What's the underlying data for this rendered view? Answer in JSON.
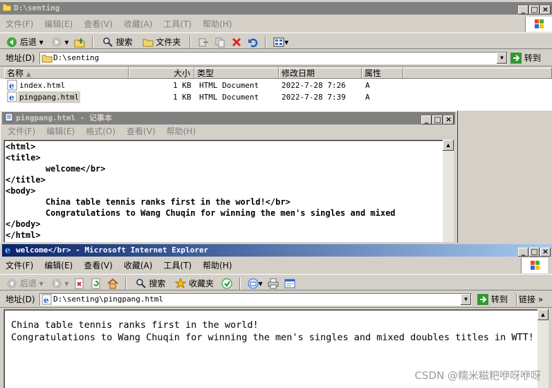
{
  "explorer": {
    "title": "D:\\senting",
    "menu": [
      "文件(F)",
      "编辑(E)",
      "查看(V)",
      "收藏(A)",
      "工具(T)",
      "帮助(H)"
    ],
    "toolbar": {
      "back": "后退",
      "search": "搜索",
      "folders": "文件夹"
    },
    "address_label": "地址(D)",
    "address_value": "D:\\senting",
    "go_label": "转到",
    "columns": [
      "名称",
      "大小",
      "类型",
      "修改日期",
      "属性"
    ],
    "files": [
      {
        "name": "index.html",
        "size": "1 KB",
        "type": "HTML Document",
        "modified": "2022-7-28 7:26",
        "attr": "A"
      },
      {
        "name": "pingpang.html",
        "size": "1 KB",
        "type": "HTML Document",
        "modified": "2022-7-28 7:39",
        "attr": "A"
      }
    ]
  },
  "notepad": {
    "title": "pingpang.html - 记事本",
    "menu": [
      "文件(F)",
      "编辑(E)",
      "格式(O)",
      "查看(V)",
      "帮助(H)"
    ],
    "lines": [
      "<html>",
      "<title>",
      "        welcome</br>",
      "</title>",
      "<body>",
      "        China table tennis ranks first in the world!</br>",
      "        Congratulations to Wang Chuqin for winning the men's singles and mixed",
      "</body>",
      "</html>"
    ]
  },
  "ie": {
    "title": "welcome</br> - Microsoft Internet Explorer",
    "menu": [
      "文件(F)",
      "编辑(E)",
      "查看(V)",
      "收藏(A)",
      "工具(T)",
      "帮助(H)"
    ],
    "toolbar": {
      "back": "后退",
      "search": "搜索",
      "favorites": "收藏夹"
    },
    "address_label": "地址(D)",
    "address_value": "D:\\senting\\pingpang.html",
    "go_label": "转到",
    "links_label": "链接",
    "content_lines": [
      "China table tennis ranks first in the world!",
      "Congratulations to Wang Chuqin for winning the men's singles and mixed doubles titles in WTT!"
    ]
  },
  "watermark": "CSDN @糯米糍粑咿呀咿呀"
}
